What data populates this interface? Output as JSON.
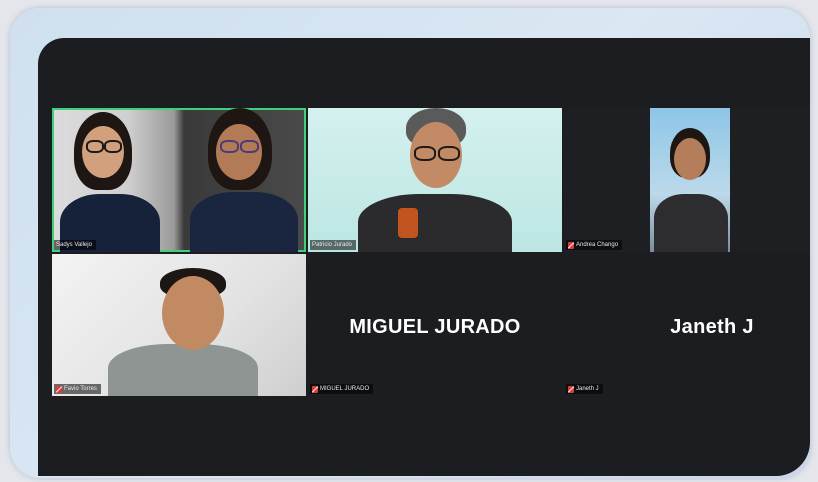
{
  "tiles": [
    {
      "label": "Sadys Vallejo",
      "muted": false,
      "active": true
    },
    {
      "label": "Patricio Jurado",
      "muted": false,
      "active": false
    },
    {
      "label": "Andrea Chango",
      "muted": true,
      "active": false
    },
    {
      "label": "Favio Torres",
      "muted": true,
      "active": false
    },
    {
      "label": "MIGUEL JURADO",
      "display_name": "MIGUEL JURADO",
      "muted": true,
      "active": false
    },
    {
      "label": "Janeth J",
      "display_name": "Janeth J",
      "muted": true,
      "active": false
    }
  ]
}
